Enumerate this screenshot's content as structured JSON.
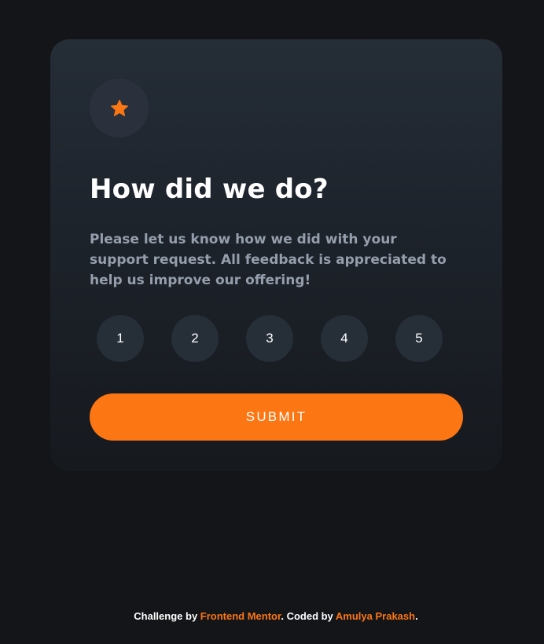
{
  "card": {
    "icon": "star-icon",
    "title": "How did we do?",
    "description": "Please let us know how we did with your support request. All feedback is appreciated to help us improve our offering!",
    "ratings": [
      "1",
      "2",
      "3",
      "4",
      "5"
    ],
    "submit_label": "SUBMIT"
  },
  "attribution": {
    "prefix": "Challenge by ",
    "challenge_link": "Frontend Mentor",
    "middle": ". Coded by ",
    "author_link": "Amulya Prakash",
    "suffix": "."
  },
  "colors": {
    "background": "#131518",
    "card_top": "#252d37",
    "card_bottom": "#16191e",
    "accent": "#fc7614",
    "rating_bg": "#262e38",
    "text_muted": "#959eac",
    "text_light": "#ffffff"
  }
}
